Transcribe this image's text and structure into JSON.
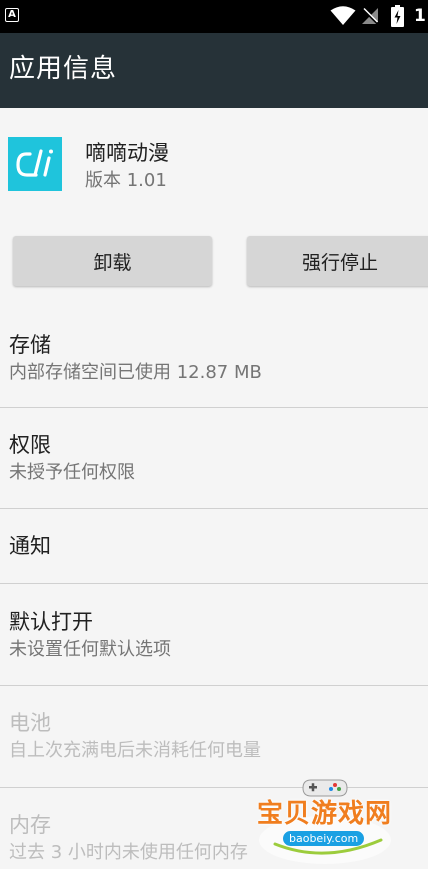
{
  "status_bar": {
    "notification_letter": "A",
    "battery_text": "1"
  },
  "app_bar": {
    "title": "应用信息"
  },
  "app": {
    "name": "嘀嘀动漫",
    "version": "版本 1.01",
    "icon_color": "#1fc4dc"
  },
  "buttons": {
    "uninstall": "卸载",
    "force_stop": "强行停止"
  },
  "sections": {
    "storage": {
      "title": "存储",
      "subtitle": "内部存储空间已使用 12.87 MB"
    },
    "permissions": {
      "title": "权限",
      "subtitle": "未授予任何权限"
    },
    "notifications": {
      "title": "通知"
    },
    "open_by_default": {
      "title": "默认打开",
      "subtitle": "未设置任何默认选项"
    },
    "battery": {
      "title": "电池",
      "subtitle": "自上次充满电后未消耗任何电量"
    },
    "memory": {
      "title": "内存",
      "subtitle": "过去 3 小时内未使用任何内存"
    }
  },
  "watermark": {
    "text": "宝贝游戏网",
    "domain": "baobeiy.com"
  },
  "colors": {
    "app_bar": "#263238",
    "status_bar": "#000000",
    "background": "#f5f5f5",
    "button": "#d6d6d6",
    "disabled_text": "#bdbdbd"
  }
}
